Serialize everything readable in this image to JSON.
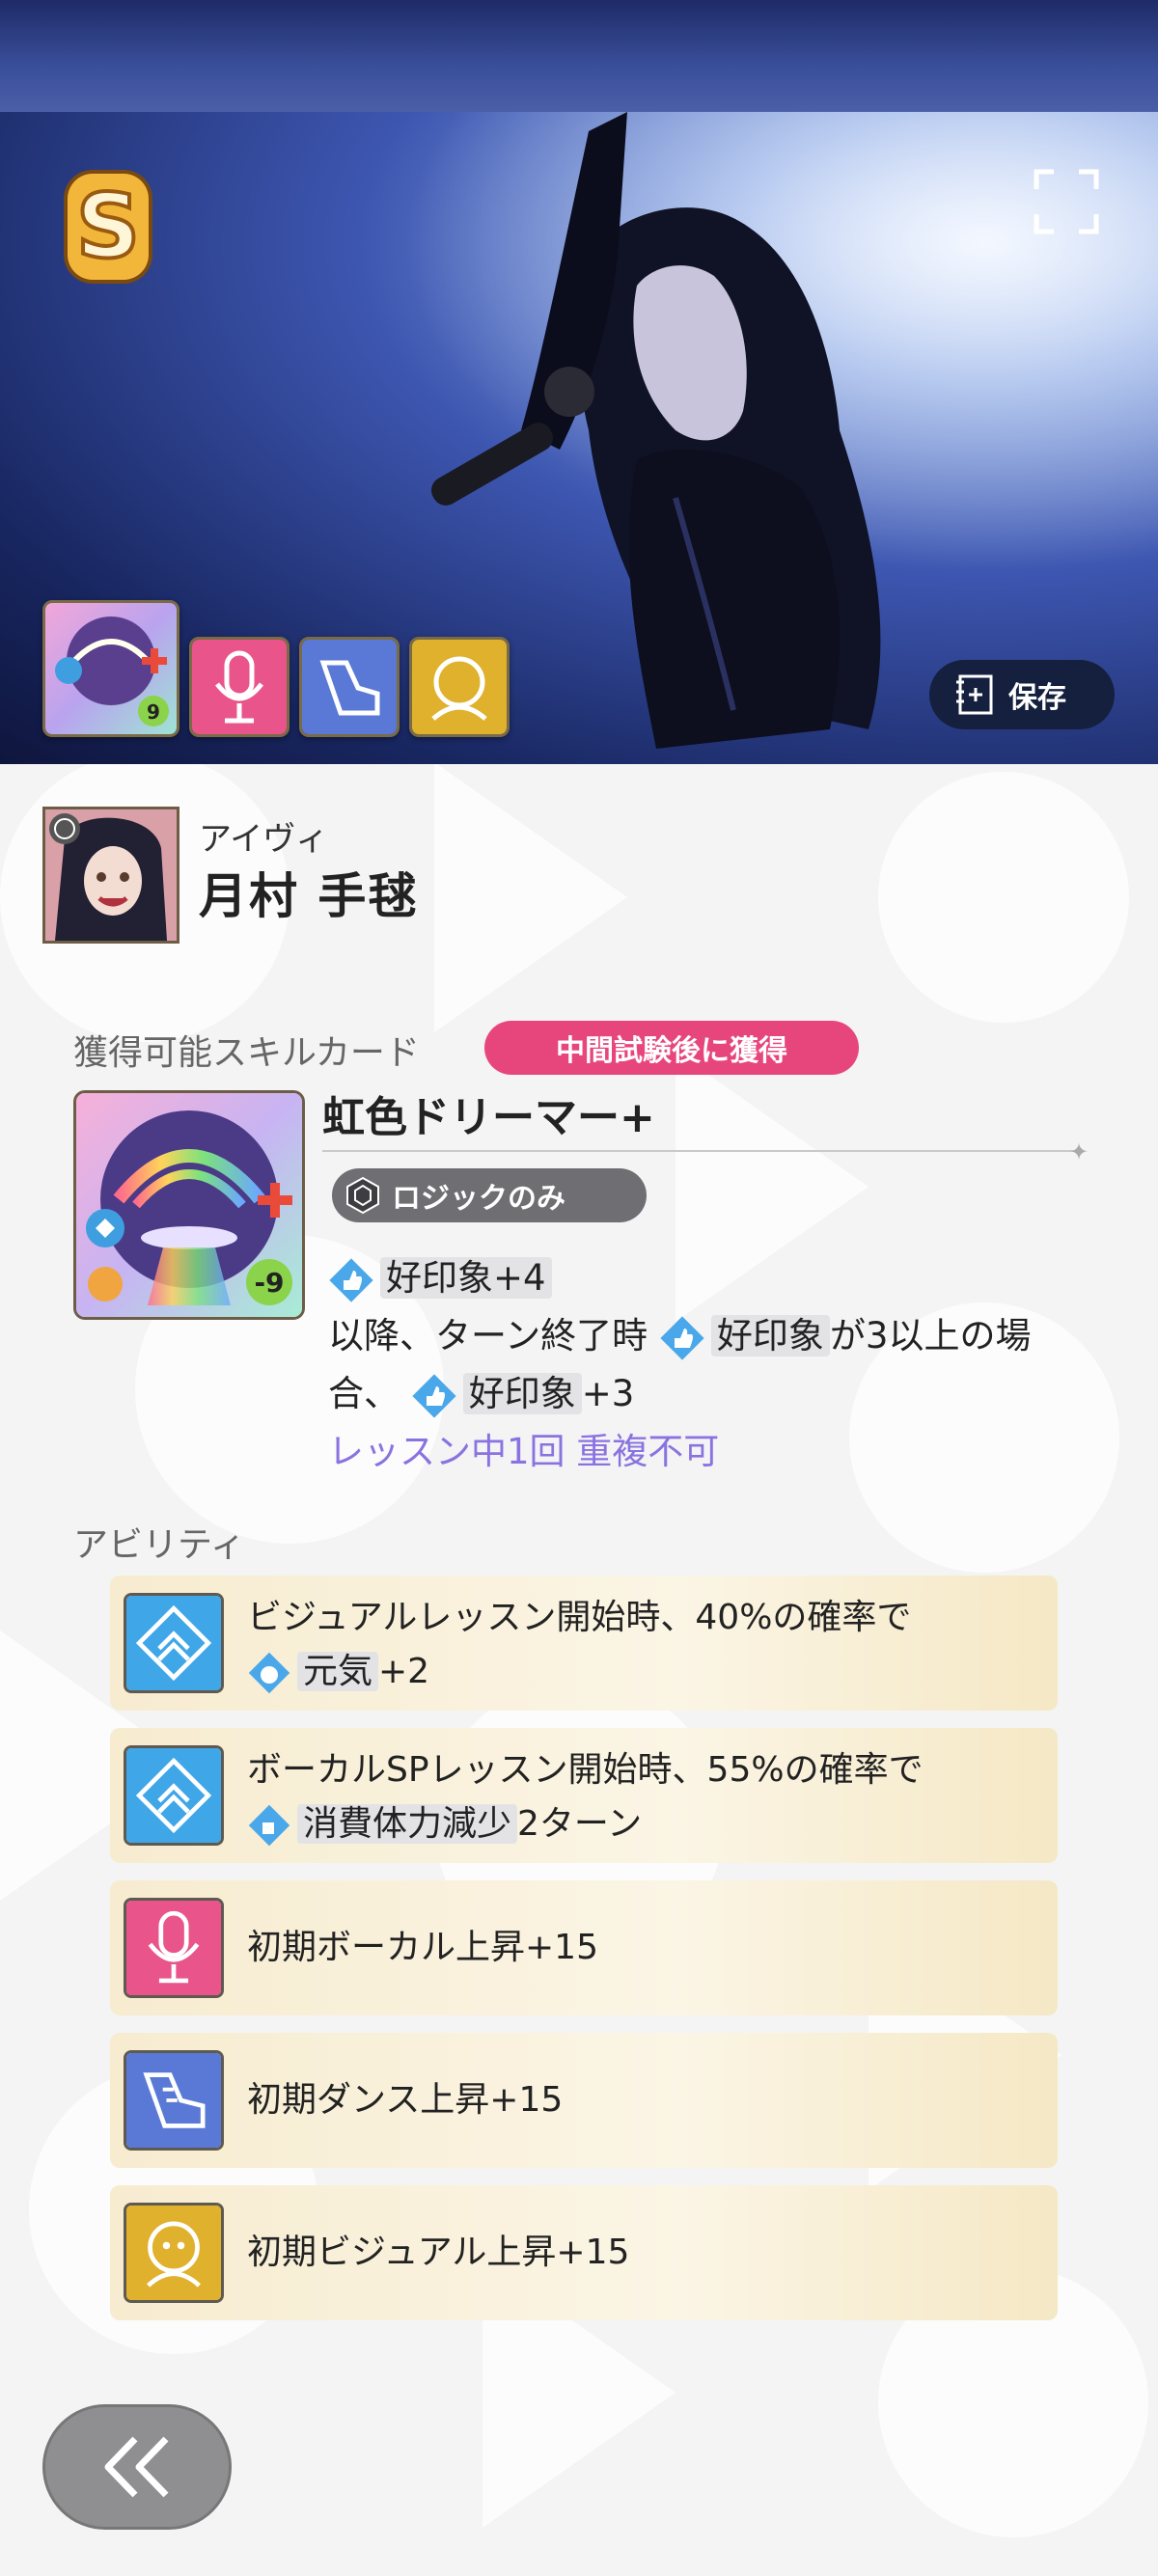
{
  "hero": {
    "rank": "S",
    "save_label": "保存",
    "skill_icons": [
      "card-icon-good-impression",
      "vocal-icon",
      "dance-icon",
      "visual-icon"
    ]
  },
  "profile": {
    "ruby": "アイヴィ",
    "name": "月村 手毬"
  },
  "skill_card_section": {
    "label": "獲得可能スキルカード",
    "badge": "中間試験後に獲得",
    "card_title": "虹色ドリーマー+",
    "card_cost": "-9",
    "logic_tag": "ロジックのみ",
    "effect_1": "好印象+4",
    "effect_2_pre": "以降、ターン終了時",
    "effect_2_hl": "好印象",
    "effect_2_post": "が3以上の場",
    "effect_3_pre": "合、",
    "effect_3_hl": "好印象",
    "effect_3_post": "+3",
    "note": "レッスン中1回 重複不可"
  },
  "ability_section": {
    "label": "アビリティ",
    "items": [
      {
        "line1": "ビジュアルレッスン開始時、40%の確率で",
        "line2_hl": "元気",
        "line2_post": "+2",
        "icon": "upgrade-diamond-icon"
      },
      {
        "line1": "ボーカルSPレッスン開始時、55%の確率で",
        "line2_hl": "消費体力減少",
        "line2_post": "2ターン",
        "icon": "upgrade-diamond-icon"
      },
      {
        "line1": "初期ボーカル上昇+15",
        "icon": "microphone-icon"
      },
      {
        "line1": "初期ダンス上昇+15",
        "icon": "dance-shoe-icon"
      },
      {
        "line1": "初期ビジュアル上昇+15",
        "icon": "visual-face-icon"
      }
    ]
  },
  "colors": {
    "badge_pink": "#e7467c",
    "note_purple": "#8a73e0",
    "vocal": "#e9548a",
    "dance": "#5a78d6",
    "visual": "#e0b12c",
    "ability_blue": "#3fa6e8"
  },
  "back_icon": "double-chevron-left-icon"
}
